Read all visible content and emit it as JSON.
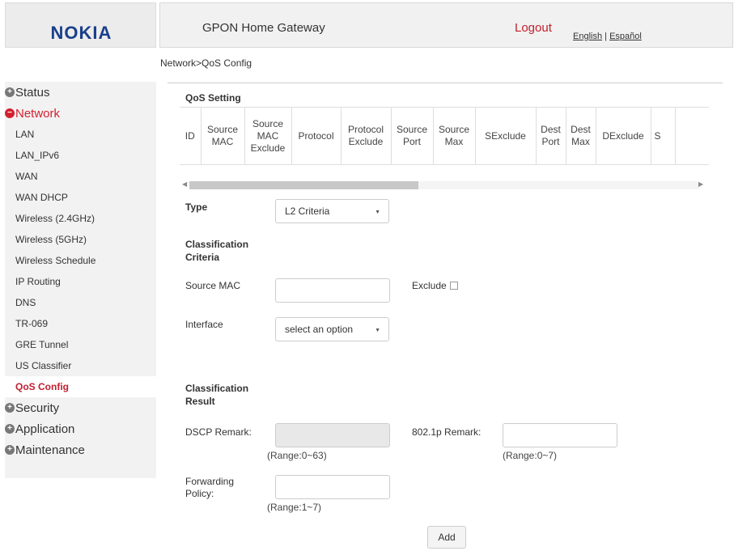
{
  "brand": {
    "logo": "NOKIA"
  },
  "header": {
    "title": "GPON Home Gateway",
    "logout": "Logout",
    "lang_en": "English",
    "lang_sep": " | ",
    "lang_es": "Español"
  },
  "breadcrumb": "Network>QoS Config",
  "sidebar": {
    "status": "Status",
    "network": "Network",
    "network_items": [
      "LAN",
      "LAN_IPv6",
      "WAN",
      "WAN DHCP",
      "Wireless (2.4GHz)",
      "Wireless (5GHz)",
      "Wireless Schedule",
      "IP Routing",
      "DNS",
      "TR-069",
      "GRE Tunnel",
      "US Classifier",
      "QoS Config"
    ],
    "security": "Security",
    "application": "Application",
    "maintenance": "Maintenance"
  },
  "qos_table": {
    "title": "QoS Setting",
    "columns": [
      "ID",
      "Source MAC",
      "Source MAC Exclude",
      "Protocol",
      "Protocol Exclude",
      "Source Port",
      "Source Max",
      "SExclude",
      "Dest Port",
      "Dest Max",
      "DExclude",
      "S"
    ]
  },
  "form": {
    "type_label": "Type",
    "type_value": "L2 Criteria",
    "criteria_heading": "Classification Criteria",
    "source_mac_label": "Source MAC",
    "source_mac_value": "",
    "exclude_label": "Exclude",
    "exclude_checked": false,
    "interface_label": "Interface",
    "interface_value": "select an option",
    "result_heading": "Classification Result",
    "dscp_label": "DSCP Remark:",
    "dscp_value": "",
    "dscp_range": "(Range:0~63)",
    "dot1p_label": "802.1p Remark:",
    "dot1p_value": "",
    "dot1p_range": "(Range:0~7)",
    "fwd_label": "Forwarding Policy:",
    "fwd_value": "",
    "fwd_range": "(Range:1~7)",
    "add_button": "Add"
  },
  "colors": {
    "accent_red": "#c41e2d",
    "logo_blue": "#1a3f8a"
  }
}
